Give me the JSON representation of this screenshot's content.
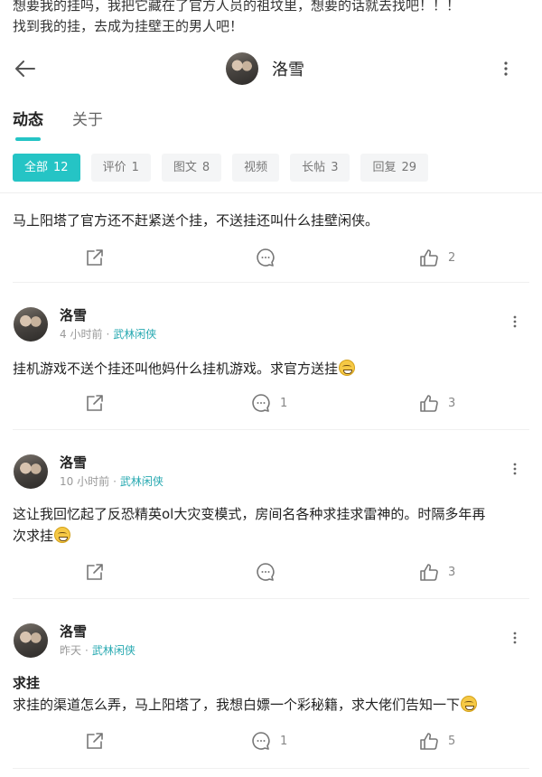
{
  "bio": {
    "line1": "想要我的挂吗，我把它藏在了官方人员的祖坟里，想要的话就去找吧！！！",
    "line2": "找到我的挂，去成为挂壁王的男人吧！"
  },
  "header": {
    "name": "洛雪"
  },
  "tabs": [
    {
      "label": "动态"
    },
    {
      "label": "关于"
    }
  ],
  "filters": [
    {
      "label": "全部",
      "count": "12"
    },
    {
      "label": "评价",
      "count": "1"
    },
    {
      "label": "图文",
      "count": "8"
    },
    {
      "label": "视频",
      "count": ""
    },
    {
      "label": "长帖",
      "count": "3"
    },
    {
      "label": "回复",
      "count": "29"
    }
  ],
  "posts": [
    {
      "body": "马上阳塔了官方还不赶紧送个挂，不送挂还叫什么挂壁闲侠。",
      "comments": "",
      "likes": "2"
    },
    {
      "author": "洛雪",
      "time": "4 小时前",
      "topic": "武林闲侠",
      "body": "挂机游戏不送个挂还叫他妈什么挂机游戏。求官方送挂",
      "emoji": "grin-emoji",
      "comments": "1",
      "likes": "3"
    },
    {
      "author": "洛雪",
      "time": "10 小时前",
      "topic": "武林闲侠",
      "body_line1": "这让我回忆起了反恐精英ol大灾变模式，房间名各种求挂求雷神的。时隔多年再",
      "body_line2": "次求挂",
      "emoji": "grin-emoji",
      "comments": "",
      "likes": "3"
    },
    {
      "author": "洛雪",
      "time": "昨天",
      "topic": "武林闲侠",
      "title": "求挂",
      "body": "求挂的渠道怎么弄，马上阳塔了，我想白嫖一个彩秘籍，求大佬们告知一下",
      "emoji": "laugh-emoji",
      "comments": "1",
      "likes": "5"
    }
  ],
  "colors": {
    "accent": "#25c4c5",
    "topic": "#25a8b0"
  }
}
